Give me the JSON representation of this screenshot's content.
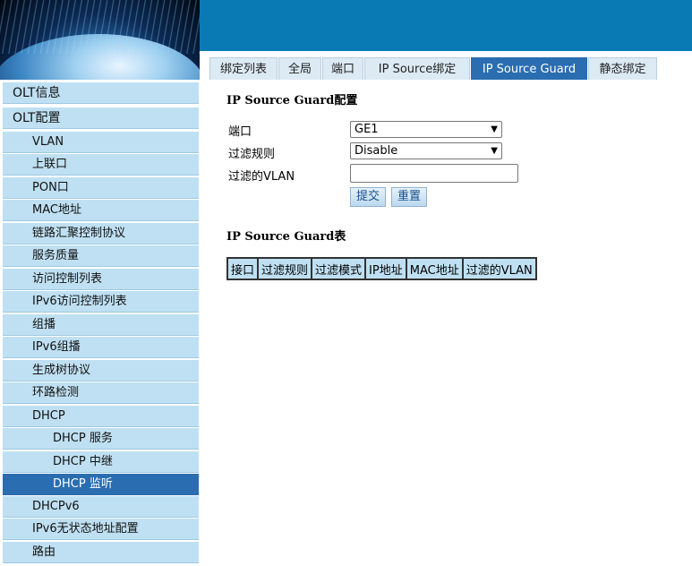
{
  "tabs": [
    "绑定列表",
    "全局",
    "端口",
    "IP Source绑定",
    "IP Source Guard",
    "静态绑定"
  ],
  "active_tab": "IP Source Guard",
  "sidebar": {
    "items": [
      {
        "label": "OLT信息",
        "level": 0
      },
      {
        "label": "OLT配置",
        "level": 0
      },
      {
        "label": "VLAN",
        "level": 1
      },
      {
        "label": "上联口",
        "level": 1
      },
      {
        "label": "PON口",
        "level": 1
      },
      {
        "label": "MAC地址",
        "level": 1
      },
      {
        "label": "链路汇聚控制协议",
        "level": 1
      },
      {
        "label": "服务质量",
        "level": 1
      },
      {
        "label": "访问控制列表",
        "level": 1
      },
      {
        "label": "IPv6访问控制列表",
        "level": 1
      },
      {
        "label": "组播",
        "level": 1
      },
      {
        "label": "IPv6组播",
        "level": 1
      },
      {
        "label": "生成树协议",
        "level": 1
      },
      {
        "label": "环路检测",
        "level": 1
      },
      {
        "label": "DHCP",
        "level": 1
      },
      {
        "label": "DHCP 服务",
        "level": 2
      },
      {
        "label": "DHCP 中继",
        "level": 2
      },
      {
        "label": "DHCP 监听",
        "level": 2,
        "active": true
      },
      {
        "label": "DHCPv6",
        "level": 1
      },
      {
        "label": "IPv6无状态地址配置",
        "level": 1
      },
      {
        "label": "路由",
        "level": 1
      }
    ]
  },
  "config": {
    "title": "IP Source Guard配置",
    "port_label": "端口",
    "port_value": "GE1",
    "rule_label": "过滤规则",
    "rule_value": "Disable",
    "vlan_label": "过滤的VLAN",
    "vlan_value": "",
    "submit_label": "提交",
    "reset_label": "重置"
  },
  "table": {
    "title": "IP Source Guard表",
    "headers": [
      "接口",
      "过滤规则",
      "过滤模式",
      "IP地址",
      "MAC地址",
      "过滤的VLAN"
    ]
  },
  "colors": {
    "header_blue": "#0a7ab5",
    "active_blue": "#2a6db0",
    "menu_bg": "#bfe0f2"
  }
}
